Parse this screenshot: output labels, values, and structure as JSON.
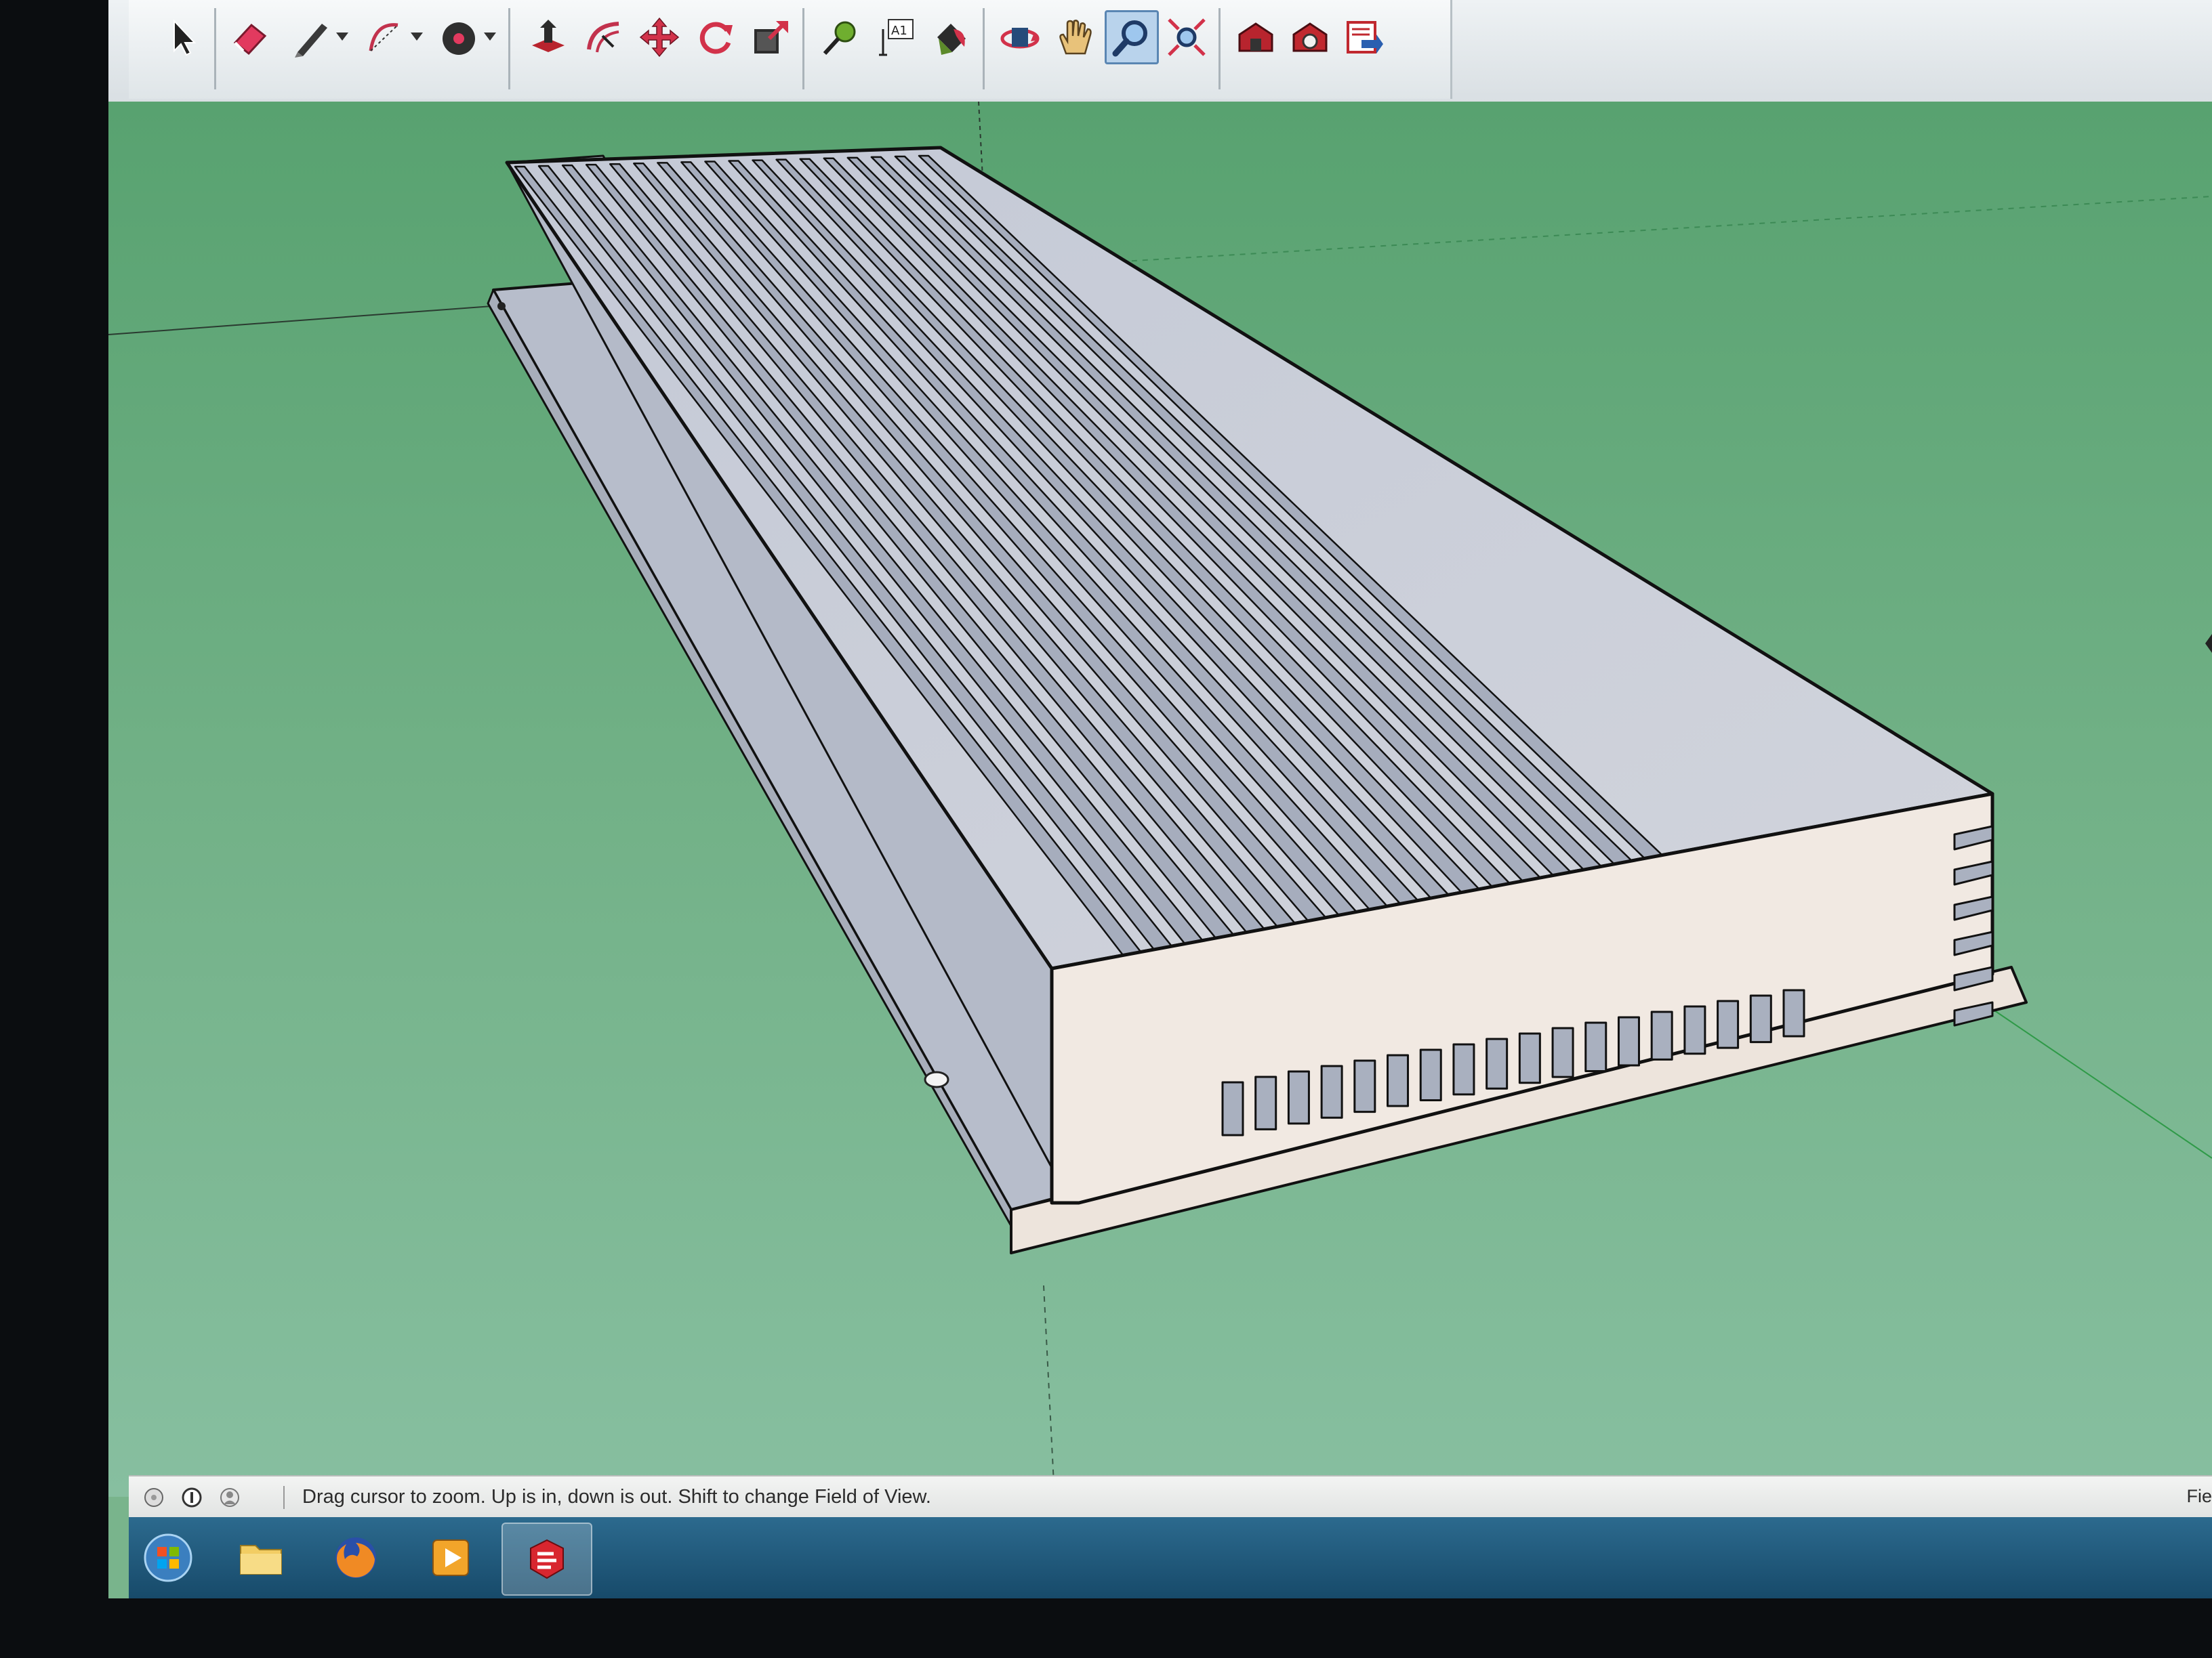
{
  "app": "SketchUp",
  "toolbar": {
    "tools": [
      {
        "name": "select",
        "icon": "arrow-cursor-icon"
      },
      {
        "name": "eraser",
        "icon": "eraser-icon"
      },
      {
        "name": "line",
        "icon": "pencil-icon"
      },
      {
        "name": "arc",
        "icon": "arc-icon"
      },
      {
        "name": "circle",
        "icon": "circle-icon"
      },
      {
        "name": "push-pull",
        "icon": "push-pull-icon"
      },
      {
        "name": "offset",
        "icon": "offset-icon"
      },
      {
        "name": "move",
        "icon": "move-icon"
      },
      {
        "name": "rotate",
        "icon": "rotate-icon"
      },
      {
        "name": "scale",
        "icon": "scale-icon"
      },
      {
        "name": "tape-measure",
        "icon": "tape-measure-icon"
      },
      {
        "name": "text",
        "icon": "text-tool-icon",
        "label": "A1"
      },
      {
        "name": "paint-bucket",
        "icon": "paint-bucket-icon"
      },
      {
        "name": "orbit",
        "icon": "orbit-icon"
      },
      {
        "name": "pan",
        "icon": "hand-icon"
      },
      {
        "name": "zoom",
        "icon": "magnifier-icon",
        "active": true
      },
      {
        "name": "zoom-extents",
        "icon": "zoom-extents-icon"
      },
      {
        "name": "warehouse",
        "icon": "warehouse-icon"
      },
      {
        "name": "extension-warehouse",
        "icon": "extension-icon"
      },
      {
        "name": "send-to-layout",
        "icon": "layout-icon"
      }
    ]
  },
  "colors": {
    "viewport_bg": "#79b48c",
    "model_top": "#c9ced9",
    "model_front": "#f1e9e2",
    "active_tool": "#b9d3ec"
  },
  "statusbar": {
    "text": "Drag cursor to zoom.  Up is in, down is out. Shift to change Field of View.",
    "right_label": "Fie"
  },
  "taskbar": {
    "items": [
      {
        "name": "start",
        "icon": "windows-start-icon"
      },
      {
        "name": "file-explorer",
        "icon": "folder-icon"
      },
      {
        "name": "firefox",
        "icon": "firefox-icon"
      },
      {
        "name": "media-player",
        "icon": "media-player-icon"
      },
      {
        "name": "sketchup",
        "icon": "sketchup-icon",
        "active": true
      }
    ]
  }
}
